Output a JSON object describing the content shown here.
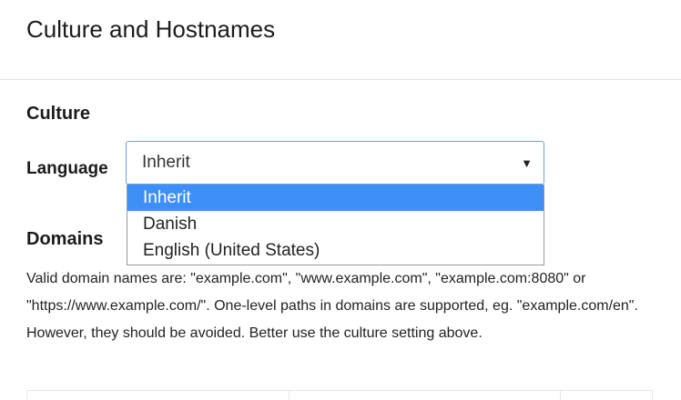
{
  "header": {
    "title": "Culture and Hostnames"
  },
  "culture": {
    "heading": "Culture",
    "language_label": "Language",
    "selected": "Inherit",
    "options": [
      "Inherit",
      "Danish",
      "English (United States)"
    ]
  },
  "domains": {
    "heading": "Domains",
    "help": "Valid domain names are: \"example.com\", \"www.example.com\", \"example.com:8080\" or \"https://www.example.com/\". One-level paths in domains are supported, eg. \"example.com/en\". However, they should be avoided. Better use the culture setting above."
  },
  "icons": {
    "select_arrow": "chevron-down-icon"
  },
  "colors": {
    "highlight": "#3d8ff7",
    "select_border": "#6ea0d8"
  }
}
